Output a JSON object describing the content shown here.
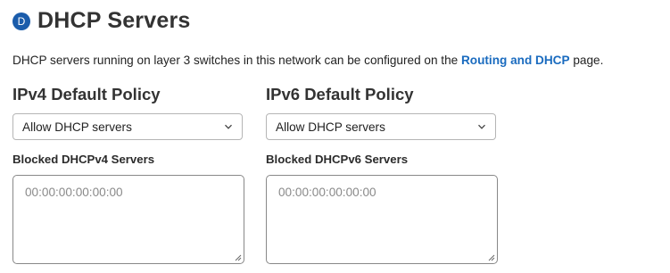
{
  "section": {
    "badge_letter": "D",
    "title": "DHCP Servers"
  },
  "description": {
    "text_before": "DHCP servers running on layer 3 switches in this network can be configured on the ",
    "link_text": "Routing and DHCP",
    "text_after": " page."
  },
  "ipv4": {
    "heading": "IPv4 Default Policy",
    "policy_select_value": "Allow DHCP servers",
    "blocked_label": "Blocked DHCPv4 Servers",
    "blocked_placeholder": "00:00:00:00:00:00",
    "blocked_value": ""
  },
  "ipv6": {
    "heading": "IPv6 Default Policy",
    "policy_select_value": "Allow DHCP servers",
    "blocked_label": "Blocked DHCPv6 Servers",
    "blocked_placeholder": "00:00:00:00:00:00",
    "blocked_value": ""
  },
  "icons": {
    "select_arrow": "chevron-down-icon",
    "resize": "resize-grip-icon"
  },
  "colors": {
    "badge": "#1a5cab",
    "link": "#1a6bbf"
  }
}
